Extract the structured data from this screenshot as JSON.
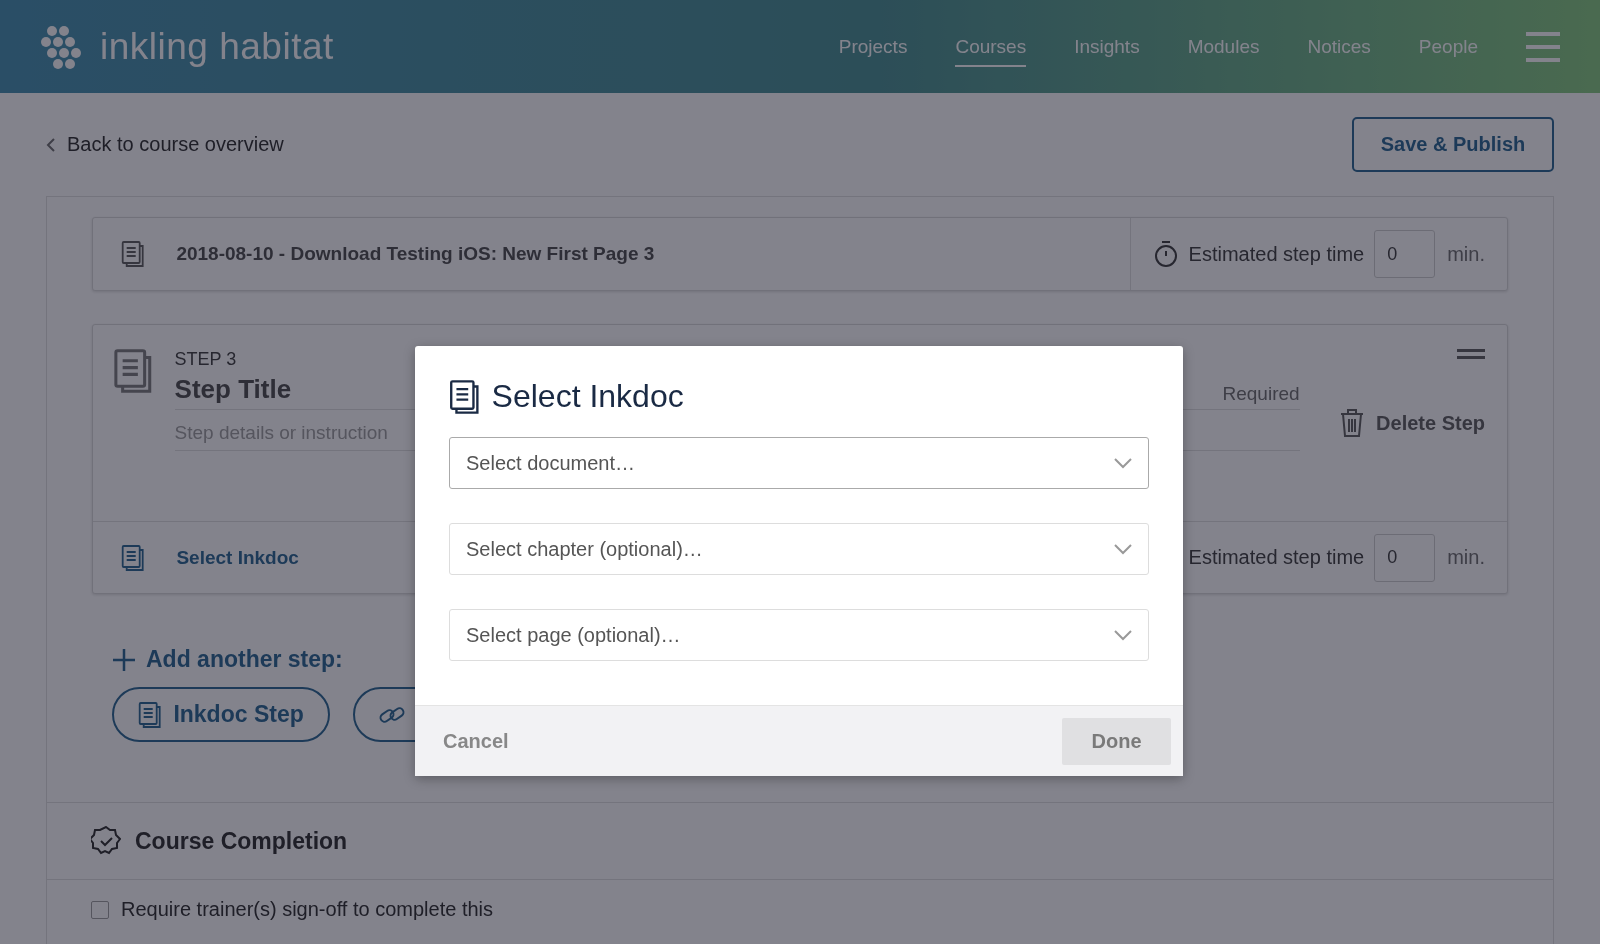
{
  "header": {
    "logo": "inkling habitat",
    "nav": [
      {
        "label": "Projects",
        "selected": false
      },
      {
        "label": "Courses",
        "selected": true
      },
      {
        "label": "Insights",
        "selected": false
      },
      {
        "label": "Modules",
        "selected": false
      },
      {
        "label": "Notices",
        "selected": false
      },
      {
        "label": "People",
        "selected": false
      }
    ]
  },
  "toolbar": {
    "back": "Back to course overview",
    "publish": "Save & Publish"
  },
  "steps": [
    {
      "kind": "inkdoc",
      "document": "2018-08-10 - Download Testing iOS: New First Page 3",
      "time_label": "Estimated step time",
      "time": "0",
      "unit": "min."
    },
    {
      "kind": "editable",
      "number": "STEP 3",
      "title": "Step Title",
      "details_placeholder": "Step details or instruction",
      "required": "Required",
      "delete": "Delete Step",
      "link": "Select Inkdoc",
      "time_label": "Estimated step time",
      "time": "0",
      "unit": "min."
    }
  ],
  "add_step": {
    "label": "Add another step:",
    "buttons": [
      {
        "kind": "inkdoc",
        "label": "Inkdoc Step"
      },
      {
        "kind": "link"
      }
    ]
  },
  "completion": {
    "title": "Course Completion",
    "options": [
      {
        "label": "Require trainer(s) sign-off to complete this",
        "checked": false
      }
    ]
  },
  "modal": {
    "title": "Select Inkdoc",
    "selects": [
      {
        "placeholder": "Select document…",
        "focused": true
      },
      {
        "placeholder": "Select chapter (optional)…",
        "focused": false
      },
      {
        "placeholder": "Select page (optional)…",
        "focused": false
      }
    ],
    "cancel": "Cancel",
    "done": "Done",
    "done_disabled": true
  }
}
